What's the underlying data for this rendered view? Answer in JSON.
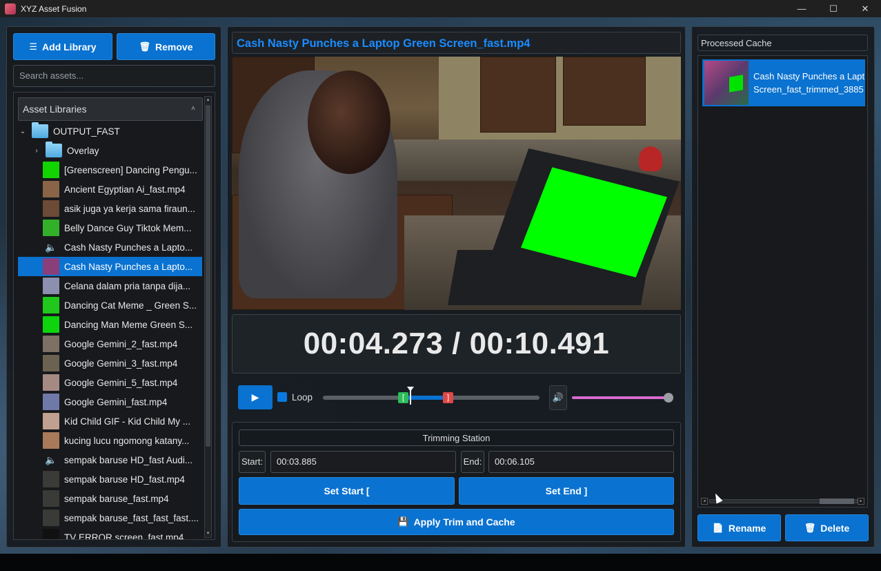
{
  "window": {
    "title": "XYZ Asset Fusion",
    "controls": [
      "—",
      "☐",
      "✕"
    ]
  },
  "library": {
    "add_label": "Add Library",
    "remove_label": "Remove",
    "search_placeholder": "Search assets...",
    "header": "Asset Libraries",
    "root_folder": "OUTPUT_FAST",
    "subfolder": "Overlay",
    "items": [
      {
        "label": "[Greenscreen] Dancing Pengu...",
        "thumb": "#12d400"
      },
      {
        "label": "Ancient Egyptian  Ai_fast.mp4",
        "thumb": "#8a6446"
      },
      {
        "label": "asik juga ya kerja sama firaun...",
        "thumb": "#6b4a36"
      },
      {
        "label": "Belly Dance Guy Tiktok Mem...",
        "thumb": "#33b02a"
      },
      {
        "label": "Cash Nasty Punches a Lapto...",
        "thumb": "audio"
      },
      {
        "label": "Cash Nasty Punches a Lapto...",
        "thumb": "#8a3e7a",
        "selected": true
      },
      {
        "label": "Celana dalam pria tanpa dija...",
        "thumb": "#8d8fb0"
      },
      {
        "label": "Dancing Cat Meme _ Green S...",
        "thumb": "#1fc81a"
      },
      {
        "label": "Dancing Man Meme Green S...",
        "thumb": "#0ed40e"
      },
      {
        "label": "Google Gemini_2_fast.mp4",
        "thumb": "#7d7064"
      },
      {
        "label": "Google Gemini_3_fast.mp4",
        "thumb": "#6b6252"
      },
      {
        "label": "Google Gemini_5_fast.mp4",
        "thumb": "#a58a84"
      },
      {
        "label": "Google Gemini_fast.mp4",
        "thumb": "#6f79a8"
      },
      {
        "label": "Kid Child GIF - Kid Child My ...",
        "thumb": "#c0a090"
      },
      {
        "label": "kucing lucu ngomong katany...",
        "thumb": "#a87a5a"
      },
      {
        "label": "sempak baruse HD_fast Audi...",
        "thumb": "audio"
      },
      {
        "label": "sempak baruse HD_fast.mp4",
        "thumb": "#3a3a36"
      },
      {
        "label": "sempak baruse_fast.mp4",
        "thumb": "#3a3a36"
      },
      {
        "label": "sempak baruse_fast_fast_fast....",
        "thumb": "#3a3a36"
      },
      {
        "label": "TV ERROR screen_fast.mp4",
        "thumb": "#111111"
      }
    ]
  },
  "player": {
    "title": "Cash Nasty Punches a Laptop Green Screen_fast.mp4",
    "time_display": "00:04.273 / 00:10.491",
    "loop_label": "Loop",
    "loop_checked": true,
    "playhead_fraction": 0.407,
    "trim_start_fraction": 0.37,
    "trim_end_fraction": 0.582,
    "volume_fraction": 1.0,
    "colors": {
      "accent": "#0a72d0",
      "title": "#1a8cff",
      "volume": "#d96ad0",
      "marker_start": "#2dbb5a",
      "marker_end": "#e04848"
    }
  },
  "trim": {
    "title": "Trimming Station",
    "start_label": "Start:",
    "start_value": "00:03.885",
    "end_label": "End:",
    "end_value": "00:06.105",
    "set_start_label": "Set Start [",
    "set_end_label": "Set End ]",
    "apply_label": "Apply Trim and Cache"
  },
  "cache": {
    "title": "Processed Cache",
    "items": [
      {
        "line1": "Cash Nasty Punches a Lapt",
        "line2": "Screen_fast_trimmed_3885"
      }
    ],
    "rename_label": "Rename",
    "delete_label": "Delete"
  }
}
